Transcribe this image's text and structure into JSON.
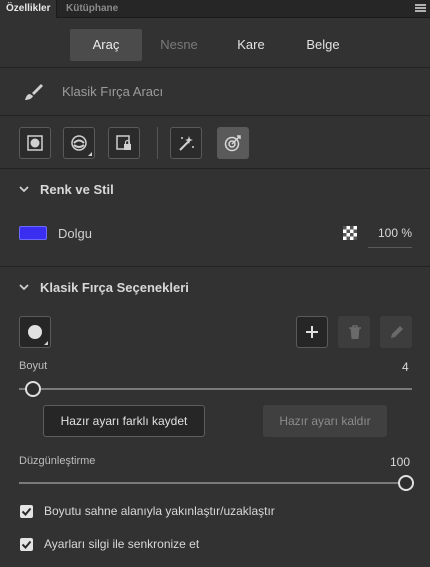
{
  "panel_tabs": {
    "properties": "Özellikler",
    "library": "Kütüphane"
  },
  "segments": {
    "tool": "Araç",
    "object": "Nesne",
    "frame": "Kare",
    "document": "Belge"
  },
  "tool": {
    "name": "Klasik Fırça Aracı"
  },
  "color_style": {
    "title": "Renk ve Stil",
    "fill_label": "Dolgu",
    "fill_color": "#3a2ff0",
    "opacity": "100 %"
  },
  "brush_options": {
    "title": "Klasik Fırça Seçenekleri",
    "size_label": "Boyut",
    "size_value": "4",
    "size_fraction": 0.0,
    "save_preset": "Hazır ayarı farklı kaydet",
    "remove_preset": "Hazır ayarı kaldır",
    "smoothing_label": "Düzgünleştirme",
    "smoothing_value": "100",
    "smoothing_fraction": 1.0,
    "checkbox_scale": "Boyutu sahne alanıyla yakınlaştır/uzaklaştır",
    "checkbox_sync": "Ayarları silgi ile senkronize et"
  }
}
